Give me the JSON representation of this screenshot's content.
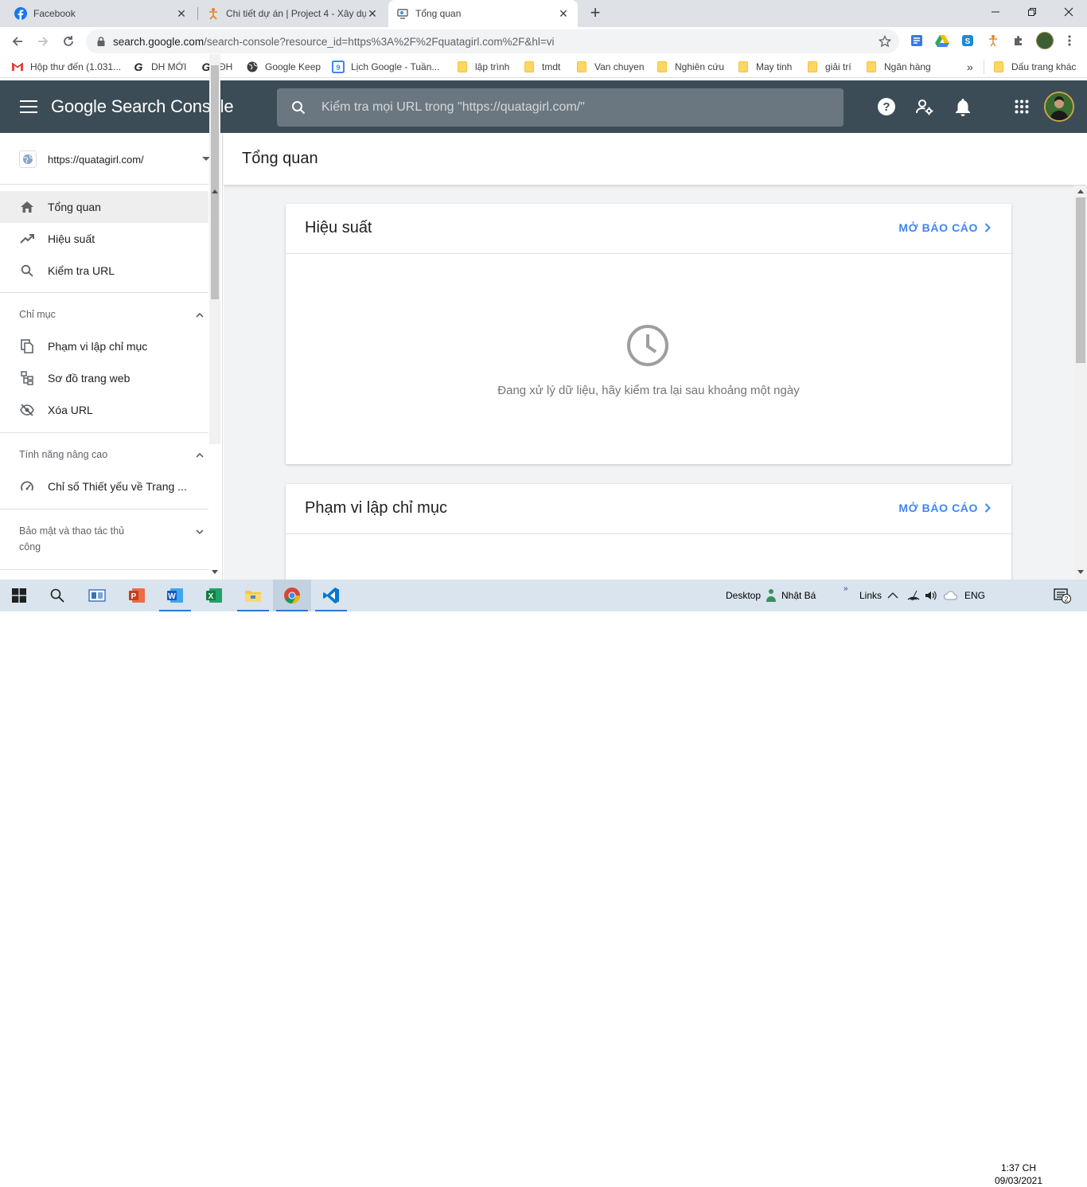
{
  "browser": {
    "tabs": [
      {
        "title": "Facebook",
        "icon": "facebook-icon"
      },
      {
        "title": "Chi tiết dự án | Project 4 - Xây dự",
        "icon": "project-icon"
      },
      {
        "title": "Tổng quan",
        "icon": "search-console-icon"
      }
    ],
    "url_host": "search.google.com",
    "url_path": "/search-console?resource_id=https%3A%2F%2Fquatagirl.com%2F&hl=vi",
    "bookmarks": [
      {
        "label": "Hộp thư đến (1.031...",
        "icon": "gmail-icon"
      },
      {
        "label": "DH MỚI",
        "icon": "g-icon"
      },
      {
        "label": "ĐH",
        "icon": "g-icon"
      },
      {
        "label": "Google Keep",
        "icon": "globe-icon"
      },
      {
        "label": "Lịch Google - Tuần...",
        "icon": "calendar-icon"
      },
      {
        "label": "lập trình",
        "icon": "folder-icon"
      },
      {
        "label": "tmdt",
        "icon": "folder-icon"
      },
      {
        "label": "Van chuyen",
        "icon": "folder-icon"
      },
      {
        "label": "Nghiên cứu",
        "icon": "folder-icon"
      },
      {
        "label": "May tinh",
        "icon": "folder-icon"
      },
      {
        "label": "giải trí",
        "icon": "folder-icon"
      },
      {
        "label": "Ngân hàng",
        "icon": "folder-icon"
      }
    ],
    "more_bookmarks": "»",
    "other_bookmarks": "Dấu trang khác",
    "calendar_day": "9"
  },
  "console": {
    "logo": "Google Search Console",
    "search_placeholder": "Kiểm tra mọi URL trong \"https://quatagirl.com/\"",
    "property": "https://quatagirl.com/"
  },
  "sidebar": {
    "nav": [
      {
        "label": "Tổng quan",
        "icon": "home-icon"
      },
      {
        "label": "Hiệu suất",
        "icon": "trending-up-icon"
      },
      {
        "label": "Kiểm tra URL",
        "icon": "search-icon"
      }
    ],
    "sections": [
      {
        "title": "Chỉ mục",
        "items": [
          {
            "label": "Phạm vi lập chỉ mục",
            "icon": "file-copy-icon"
          },
          {
            "label": "Sơ đồ trang web",
            "icon": "sitemap-icon"
          },
          {
            "label": "Xóa URL",
            "icon": "visibility-off-icon"
          }
        ]
      },
      {
        "title": "Tính năng nâng cao",
        "items": [
          {
            "label": "Chỉ số Thiết yếu về Trang ...",
            "icon": "speed-icon"
          }
        ]
      },
      {
        "title": "Bảo mật và thao tác thủ công",
        "items": []
      }
    ]
  },
  "main": {
    "title": "Tổng quan",
    "cards": [
      {
        "title": "Hiệu suất",
        "link": "MỞ BÁO CÁO",
        "message": "Đang xử lý dữ liệu, hãy kiểm tra lại sau khoảng một ngày"
      },
      {
        "title": "Phạm vi lập chỉ mục",
        "link": "MỞ BÁO CÁO"
      }
    ]
  },
  "taskbar": {
    "desktop": "Desktop",
    "user": "Nhật Bá",
    "links": "Links",
    "lang": "ENG",
    "time": "1:37 CH",
    "date": "09/03/2021",
    "notifications": "2",
    "more": "»"
  },
  "colors": {
    "header": "#3c4c56",
    "accent": "#4285f4",
    "active_nav": "#eeeeee"
  }
}
